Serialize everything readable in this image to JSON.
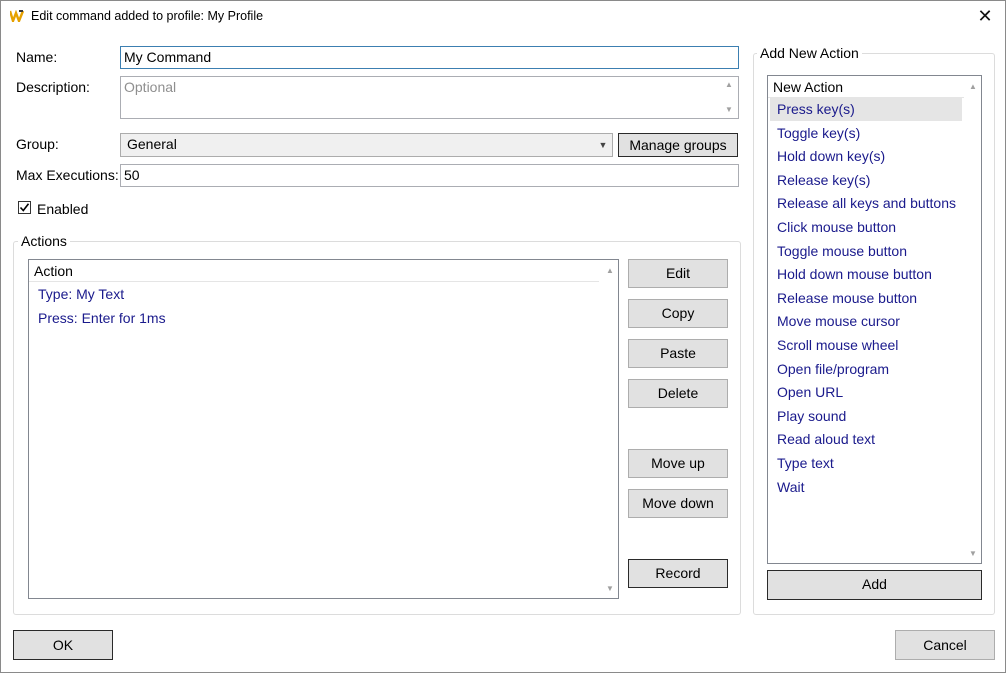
{
  "window": {
    "title": "Edit command added to profile: My Profile",
    "close_glyph": "✕"
  },
  "form": {
    "name_label": "Name:",
    "name_value": "My Command",
    "description_label": "Description:",
    "description_placeholder": "Optional",
    "group_label": "Group:",
    "group_value": "General",
    "manage_groups_label": "Manage groups",
    "max_exec_label": "Max Executions:",
    "max_exec_value": "50",
    "enabled_label": "Enabled",
    "enabled_checked": true
  },
  "actions": {
    "group_title": "Actions",
    "column_header": "Action",
    "items": [
      "Type: My Text",
      "Press: Enter for 1ms"
    ],
    "buttons": {
      "edit": "Edit",
      "copy": "Copy",
      "paste": "Paste",
      "delete": "Delete",
      "move_up": "Move up",
      "move_down": "Move down",
      "record": "Record"
    }
  },
  "new_action": {
    "group_title": "Add New Action",
    "column_header": "New Action",
    "selected_index": 0,
    "items": [
      "Press key(s)",
      "Toggle key(s)",
      "Hold down key(s)",
      "Release key(s)",
      "Release all keys and buttons",
      "Click mouse button",
      "Toggle mouse button",
      "Hold down mouse button",
      "Release mouse button",
      "Move mouse cursor",
      "Scroll mouse wheel",
      "Open file/program",
      "Open URL",
      "Play sound",
      "Read aloud text",
      "Type text",
      "Wait"
    ],
    "add_label": "Add"
  },
  "footer": {
    "ok_label": "OK",
    "cancel_label": "Cancel"
  },
  "colors": {
    "link_text": "#1a1a8c",
    "selected_bg": "#e5e5e5",
    "focus_border": "#3c7fb1",
    "logo_accent": "#f0a000"
  },
  "icons": {
    "app": "w-logo-icon",
    "close": "close-icon",
    "dropdown": "chevron-down-icon",
    "check": "checkmark-icon"
  }
}
